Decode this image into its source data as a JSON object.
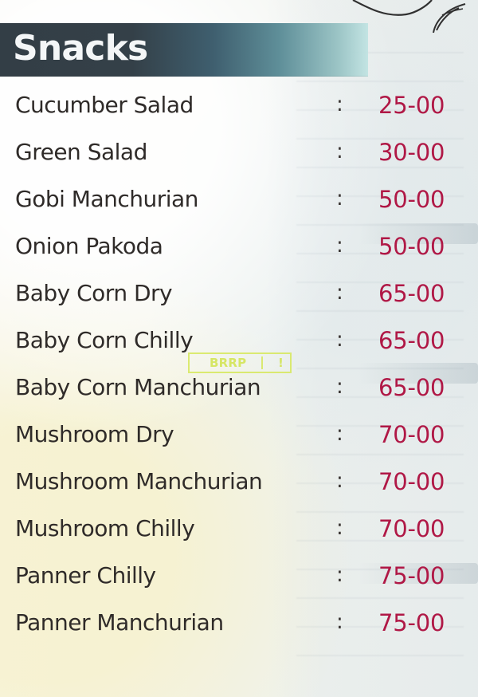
{
  "section": {
    "title": "Snacks"
  },
  "menu_items": [
    {
      "name": "Cucumber Salad",
      "separator": ":",
      "price": "25-00"
    },
    {
      "name": "Green Salad",
      "separator": ":",
      "price": "30-00"
    },
    {
      "name": "Gobi Manchurian",
      "separator": ":",
      "price": "50-00"
    },
    {
      "name": "Onion Pakoda",
      "separator": ":",
      "price": "50-00"
    },
    {
      "name": "Baby Corn Dry",
      "separator": ":",
      "price": "65-00"
    },
    {
      "name": "Baby Corn Chilly",
      "separator": ":",
      "price": "65-00"
    },
    {
      "name": "Baby Corn Manchurian",
      "separator": ":",
      "price": "65-00"
    },
    {
      "name": "Mushroom Dry",
      "separator": ":",
      "price": "70-00"
    },
    {
      "name": "Mushroom Manchurian",
      "separator": ":",
      "price": "70-00"
    },
    {
      "name": "Mushroom Chilly",
      "separator": ":",
      "price": "70-00"
    },
    {
      "name": "Panner Chilly",
      "separator": ":",
      "price": "75-00"
    },
    {
      "name": "Panner Manchurian",
      "separator": ":",
      "price": "75-00"
    }
  ],
  "watermark": {
    "text": "BRRP",
    "mark": "!"
  },
  "colors": {
    "header_dark": "#333e46",
    "header_light": "#9cc5c6",
    "price": "#b01846",
    "text": "#2f2b29",
    "watermark": "#d3e455"
  }
}
